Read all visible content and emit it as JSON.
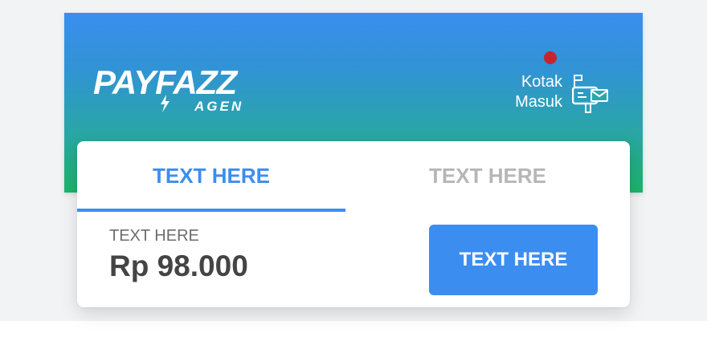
{
  "header": {
    "logo": {
      "main": "PAYFAZZ",
      "sub": "AGEN"
    },
    "inbox": {
      "line1": "Kotak",
      "line2": "Masuk",
      "has_notification": true
    },
    "colors": {
      "gradient_top": "#3b8eee",
      "gradient_bottom": "#1db36a",
      "notification": "#c4262d"
    }
  },
  "tabs": [
    {
      "label": "TEXT HERE",
      "active": true
    },
    {
      "label": "TEXT HERE",
      "active": false
    }
  ],
  "balance": {
    "label": "TEXT HERE",
    "value": "Rp 98.000"
  },
  "action_button": {
    "label": "TEXT HERE"
  },
  "colors": {
    "accent": "#3b8ef0",
    "inactive_tab": "#b6b6b6"
  }
}
